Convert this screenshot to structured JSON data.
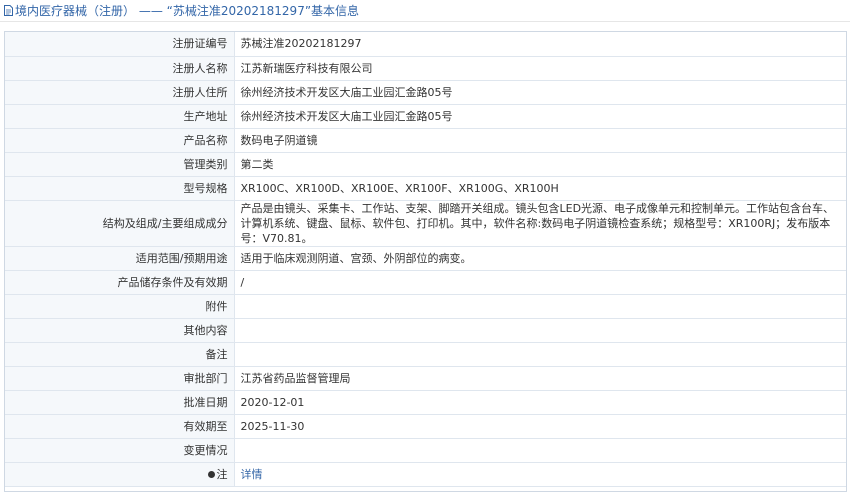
{
  "header": {
    "title": "境内医疗器械（注册） —— “苏械注准20202181297”基本信息"
  },
  "rows": [
    {
      "label": "注册证编号",
      "value": "苏械注准20202181297"
    },
    {
      "label": "注册人名称",
      "value": "江苏新瑞医疗科技有限公司"
    },
    {
      "label": "注册人住所",
      "value": "徐州经济技术开发区大庙工业园汇金路05号"
    },
    {
      "label": "生产地址",
      "value": "徐州经济技术开发区大庙工业园汇金路05号"
    },
    {
      "label": "产品名称",
      "value": "数码电子阴道镜"
    },
    {
      "label": "管理类别",
      "value": "第二类"
    },
    {
      "label": "型号规格",
      "value": "XR100C、XR100D、XR100E、XR100F、XR100G、XR100H"
    },
    {
      "label": "结构及组成/主要组成成分",
      "value": "产品是由镜头、采集卡、工作站、支架、脚踏开关组成。镜头包含LED光源、电子成像单元和控制单元。工作站包含台车、计算机系统、键盘、鼠标、软件包、打印机。其中，软件名称:数码电子阴道镜检查系统；规格型号：XR100RJ；发布版本号：V70.81。"
    },
    {
      "label": "适用范围/预期用途",
      "value": "适用于临床观测阴道、宫颈、外阴部位的病变。"
    },
    {
      "label": "产品储存条件及有效期",
      "value": "/"
    },
    {
      "label": "附件",
      "value": ""
    },
    {
      "label": "其他内容",
      "value": ""
    },
    {
      "label": "备注",
      "value": ""
    },
    {
      "label": "审批部门",
      "value": "江苏省药品监督管理局"
    },
    {
      "label": "批准日期",
      "value": "2020-12-01"
    },
    {
      "label": "有效期至",
      "value": "2025-11-30"
    },
    {
      "label": "变更情况",
      "value": ""
    },
    {
      "label": "注",
      "value": "详情"
    }
  ],
  "colors": {
    "link": "#3366a8",
    "border": "#dfe6ee",
    "label_bg": "#f5f8fb"
  }
}
